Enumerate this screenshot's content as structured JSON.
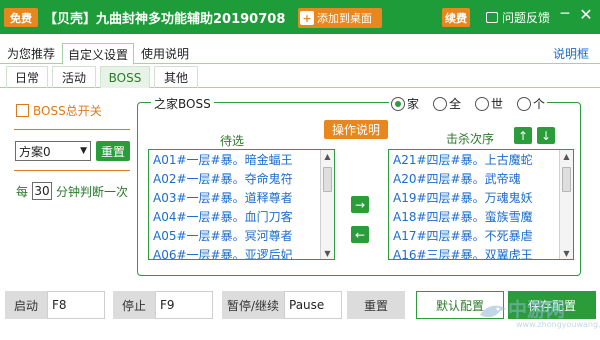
{
  "titlebar": {
    "badge": "免费",
    "title": "【贝壳】九曲封神多功能辅助20190708",
    "add_desktop": "添加到桌面",
    "renew": "续费",
    "feedback": "问题反馈",
    "minimize": "─",
    "close": "✕",
    "bg_color": "#1e9c3a",
    "accent_color": "#e8871e"
  },
  "tabs_top": {
    "items": [
      "为您推荐",
      "自定义设置",
      "使用说明"
    ],
    "active_index": 1,
    "help_box": "说明框"
  },
  "tabs_sub": {
    "items": [
      "日常",
      "活动",
      "BOSS",
      "其他"
    ],
    "active_index": 2
  },
  "left_panel": {
    "boss_toggle": "BOSS总开关",
    "plan_value": "方案0",
    "reset": "重置",
    "minutes_prefix": "每",
    "minutes_value": "30",
    "minutes_suffix": "分钟判断一次"
  },
  "boss_group": {
    "label": "之家BOSS",
    "radios": [
      {
        "label": "家",
        "selected": true
      },
      {
        "label": "全",
        "selected": false
      },
      {
        "label": "世",
        "selected": false
      },
      {
        "label": "个",
        "selected": false
      }
    ],
    "pending_header": "待选",
    "kill_order_header": "击杀次序",
    "op_help": "操作说明",
    "move_up": "↑",
    "move_down": "↓",
    "add_arrow": "→",
    "remove_arrow": "←",
    "pending_list": [
      "A01#一层#暴。暗金蝠王",
      "A02#一层#暴。夺命鬼符",
      "A03#一层#暴。道释尊者",
      "A04#一层#暴。血门刀客",
      "A05#一层#暴。冥河尊者",
      "A06#一层#暴。亚逻后妃"
    ],
    "kill_list": [
      "A21#四层#暴。上古魔蛇",
      "A20#四层#暴。武帝魂",
      "A19#四层#暴。万魂鬼妖",
      "A18#四层#暴。蛮族雪魔",
      "A17#四层#暴。不死暴虐",
      "A16#三层#暴。双翼虎王"
    ]
  },
  "bottom": {
    "start_label": "启动",
    "start_key": "F8",
    "stop_label": "停止",
    "stop_key": "F9",
    "pause_label": "暂停/继续",
    "pause_key": "Pause",
    "reset": "重置",
    "default_btn": "默认配置",
    "save_btn": "保存配置"
  },
  "watermark": {
    "text": "中游网",
    "sub": "www.zhongyouwang.com"
  }
}
